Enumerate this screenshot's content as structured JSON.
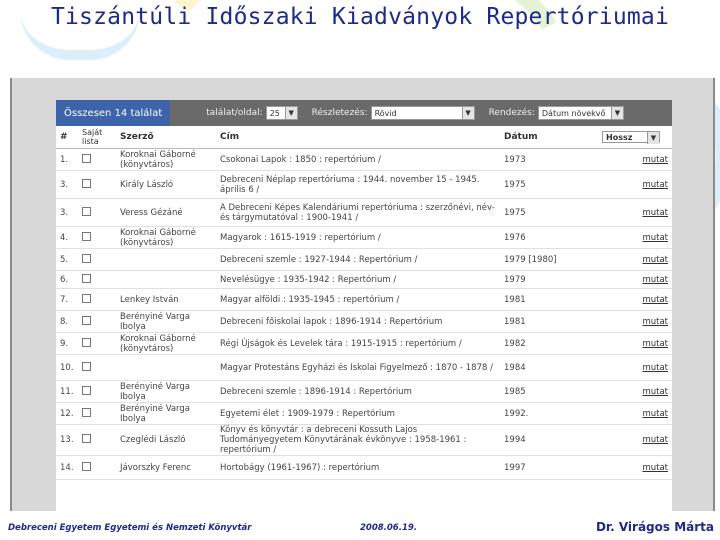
{
  "header": {
    "title": "Tiszántúli Időszaki Kiadványok Repertóriumai"
  },
  "toolbar": {
    "total": "Összesen 14 találat",
    "per_page_label": "találat/oldal:",
    "per_page_value": "25",
    "detail_label": "Részletezés:",
    "detail_value": "Rövid",
    "order_label": "Rendezés:",
    "order_value": "Dátum növekvő"
  },
  "table": {
    "headers": {
      "num": "#",
      "own": "Saját lista",
      "author": "Szerző",
      "title": "Cím",
      "date": "Dátum",
      "sort": "Hossz"
    },
    "more_label": "mutat",
    "rows": [
      {
        "num": "1.",
        "author": "Koroknai Gáborné (könyvtáros)",
        "title": "Csokonai Lapok : 1850 : repertórium /",
        "date": "1973"
      },
      {
        "num": "3.",
        "author": "Király László",
        "title": "Debreceni Néplap repertóriuma : 1944. november 15 - 1945. április 6 /",
        "date": "1975"
      },
      {
        "num": "3.",
        "author": "Veress Gézáné",
        "title": "A Debreceni Képes Kalendáriumi repertóriuma : szerzőnévi, név- és tárgymutatóval : 1900-1941 /",
        "date": "1975"
      },
      {
        "num": "4.",
        "author": "Koroknai Gáborné (könyvtáros)",
        "title": "Magyarok : 1615-1919 : repertórium /",
        "date": "1976"
      },
      {
        "num": "5.",
        "author": "",
        "title": "Debreceni szemle : 1927-1944 : Repertórium /",
        "date": "1979 [1980]"
      },
      {
        "num": "6.",
        "author": "",
        "title": "Nevelésügye : 1935-1942 : Repertórium /",
        "date": "1979"
      },
      {
        "num": "7.",
        "author": "Lenkey István",
        "title": "Magyar alföldi : 1935-1945 : repertórium /",
        "date": "1981"
      },
      {
        "num": "8.",
        "author": "Berényiné Varga Ibolya",
        "title": "Debreceni főiskolai lapok : 1896-1914 : Repertórium",
        "date": "1981"
      },
      {
        "num": "9.",
        "author": "Koroknai Gáborné (könyvtáros)",
        "title": "Régi Újságok és Levelek tára : 1915-1915 : repertórium /",
        "date": "1982"
      },
      {
        "num": "10.",
        "author": "",
        "title": "Magyar Protestáns Egyházi és Iskolai Figyelmező : 1870 - 1878 /",
        "date": "1984"
      },
      {
        "num": "11.",
        "author": "Berényiné Varga Ibolya",
        "title": "Debreceni szemle : 1896-1914 : Repertórium",
        "date": "1985"
      },
      {
        "num": "12.",
        "author": "Berényiné Varga Ibolya",
        "title": "Egyetemi élet : 1909-1979 : Repertórium",
        "date": "1992."
      },
      {
        "num": "13.",
        "author": "Czeglédi László",
        "title": "Könyv és könyvtár : a debreceni Kossuth Lajos Tudományegyetem Könyvtárának évkönyve : 1958-1961 : repertórium /",
        "date": "1994"
      },
      {
        "num": "14.",
        "author": "Jávorszky Ferenc",
        "title": "Hortobágy (1961-1967) : repertórium",
        "date": "1997"
      }
    ]
  },
  "footer": {
    "left": "Debreceni Egyetem Egyetemi és Nemzeti Könyvtár",
    "date": "2008.06.19.",
    "author": "Dr. Virágos Márta"
  }
}
